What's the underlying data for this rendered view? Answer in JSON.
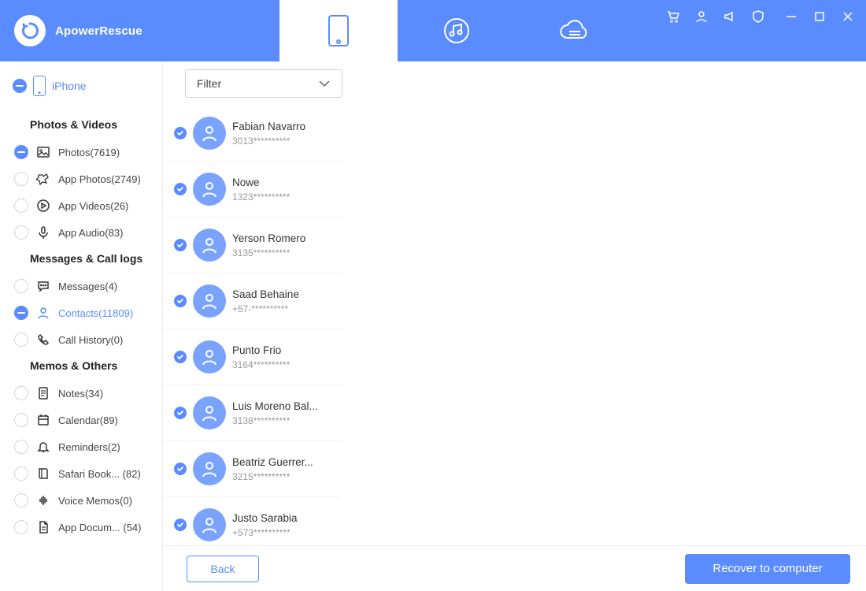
{
  "app": {
    "name": "ApowerRescue"
  },
  "device": {
    "label": "iPhone"
  },
  "sidebar": {
    "sections": [
      {
        "title": "Photos & Videos",
        "items": [
          {
            "label": "Photos(7619)",
            "checked": true,
            "icon": "image"
          },
          {
            "label": "App Photos(2749)",
            "checked": false,
            "icon": "appphotos"
          },
          {
            "label": "App Videos(26)",
            "checked": false,
            "icon": "play"
          },
          {
            "label": "App Audio(83)",
            "checked": false,
            "icon": "mic"
          }
        ]
      },
      {
        "title": "Messages & Call logs",
        "items": [
          {
            "label": "Messages(4)",
            "checked": false,
            "icon": "message"
          },
          {
            "label": "Contacts(11809)",
            "checked": true,
            "icon": "person",
            "active": true
          },
          {
            "label": "Call History(0)",
            "checked": false,
            "icon": "phone"
          }
        ]
      },
      {
        "title": "Memos & Others",
        "items": [
          {
            "label": "Notes(34)",
            "checked": false,
            "icon": "note"
          },
          {
            "label": "Calendar(89)",
            "checked": false,
            "icon": "calendar"
          },
          {
            "label": "Reminders(2)",
            "checked": false,
            "icon": "bell"
          },
          {
            "label": "Safari Book... (82)",
            "checked": false,
            "icon": "book"
          },
          {
            "label": "Voice Memos(0)",
            "checked": false,
            "icon": "voice"
          },
          {
            "label": "App Docum... (54)",
            "checked": false,
            "icon": "doc"
          }
        ]
      }
    ]
  },
  "filter": {
    "label": "Filter"
  },
  "contacts": [
    {
      "name": "Fabian Navarro",
      "phone": "3013**********",
      "checked": true
    },
    {
      "name": "Nowe",
      "phone": "1323**********",
      "checked": true
    },
    {
      "name": "Yerson Romero",
      "phone": "3135**********",
      "checked": true
    },
    {
      "name": "Saad Behaine",
      "phone": "+57-**********",
      "checked": true
    },
    {
      "name": "Punto Frio",
      "phone": "3164**********",
      "checked": true
    },
    {
      "name": "Luis Moreno Bal...",
      "phone": "3138**********",
      "checked": true
    },
    {
      "name": "Beatriz Guerrer...",
      "phone": "3215**********",
      "checked": true
    },
    {
      "name": "Justo Sarabia",
      "phone": "+573**********",
      "checked": true
    }
  ],
  "footer": {
    "back": "Back",
    "recover": "Recover to computer"
  }
}
